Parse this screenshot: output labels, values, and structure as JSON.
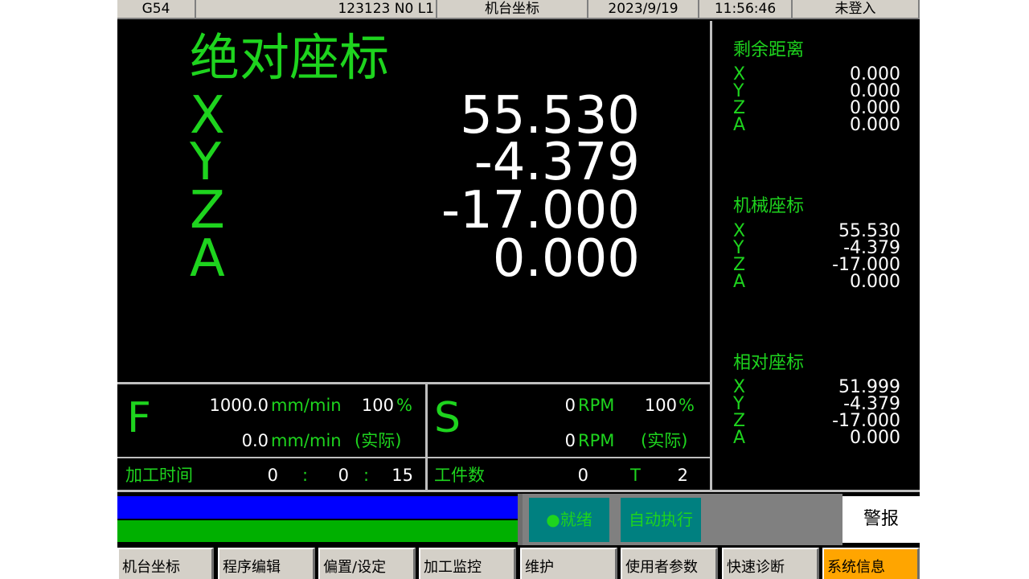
{
  "status_bar": {
    "coord_system": "G54",
    "program": "123123 N0 L1",
    "screen": "机台坐标",
    "date": "2023/9/19",
    "time": "11:56:46",
    "user": "未登入"
  },
  "absolute": {
    "title": "绝对座标",
    "axes": [
      {
        "axis": "X",
        "value": "55.530"
      },
      {
        "axis": "Y",
        "value": "-4.379"
      },
      {
        "axis": "Z",
        "value": "-17.000"
      },
      {
        "axis": "A",
        "value": "0.000"
      }
    ]
  },
  "remaining": {
    "title": "剩余距离",
    "axes": [
      {
        "axis": "X",
        "value": "0.000"
      },
      {
        "axis": "Y",
        "value": "0.000"
      },
      {
        "axis": "Z",
        "value": "0.000"
      },
      {
        "axis": "A",
        "value": "0.000"
      }
    ]
  },
  "machine": {
    "title": "机械座标",
    "axes": [
      {
        "axis": "X",
        "value": "55.530"
      },
      {
        "axis": "Y",
        "value": "-4.379"
      },
      {
        "axis": "Z",
        "value": "-17.000"
      },
      {
        "axis": "A",
        "value": "0.000"
      }
    ]
  },
  "relative": {
    "title": "相对座标",
    "axes": [
      {
        "axis": "X",
        "value": "51.999"
      },
      {
        "axis": "Y",
        "value": "-4.379"
      },
      {
        "axis": "Z",
        "value": "-17.000"
      },
      {
        "axis": "A",
        "value": "0.000"
      }
    ]
  },
  "feed": {
    "label": "F",
    "cmd_value": "1000.0",
    "actual_value": "0.0",
    "unit": "mm/min",
    "override": "100",
    "pct": "%",
    "actual_label": "(实际)"
  },
  "spindle": {
    "label": "S",
    "cmd_value": "0",
    "actual_value": "0",
    "unit": "RPM",
    "override": "100",
    "pct": "%",
    "actual_label": "(实际)"
  },
  "process_time": {
    "label": "加工时间",
    "hours": "0",
    "minutes": "0",
    "seconds": "15",
    "sep": ":"
  },
  "workpiece": {
    "label": "工件数",
    "count": "0",
    "tool_label": "T",
    "tool": "2"
  },
  "status": {
    "ready": "●就绪",
    "auto_run": "自动执行",
    "alarm": "警报"
  },
  "softkeys": [
    "机台坐标",
    "程序编辑",
    "偏置/设定",
    "加工监控",
    "维护",
    "使用者参数",
    "快速诊断",
    "系统信息"
  ],
  "colors": {
    "background": "#000000",
    "axis_label": "#1ed41e",
    "value": "#ffffff",
    "panel_gray": "#d4d0c8",
    "status_teal": "#008080",
    "blue_bar": "#0000ff",
    "green_bar": "#00b000",
    "active_softkey": "#ffa500"
  }
}
